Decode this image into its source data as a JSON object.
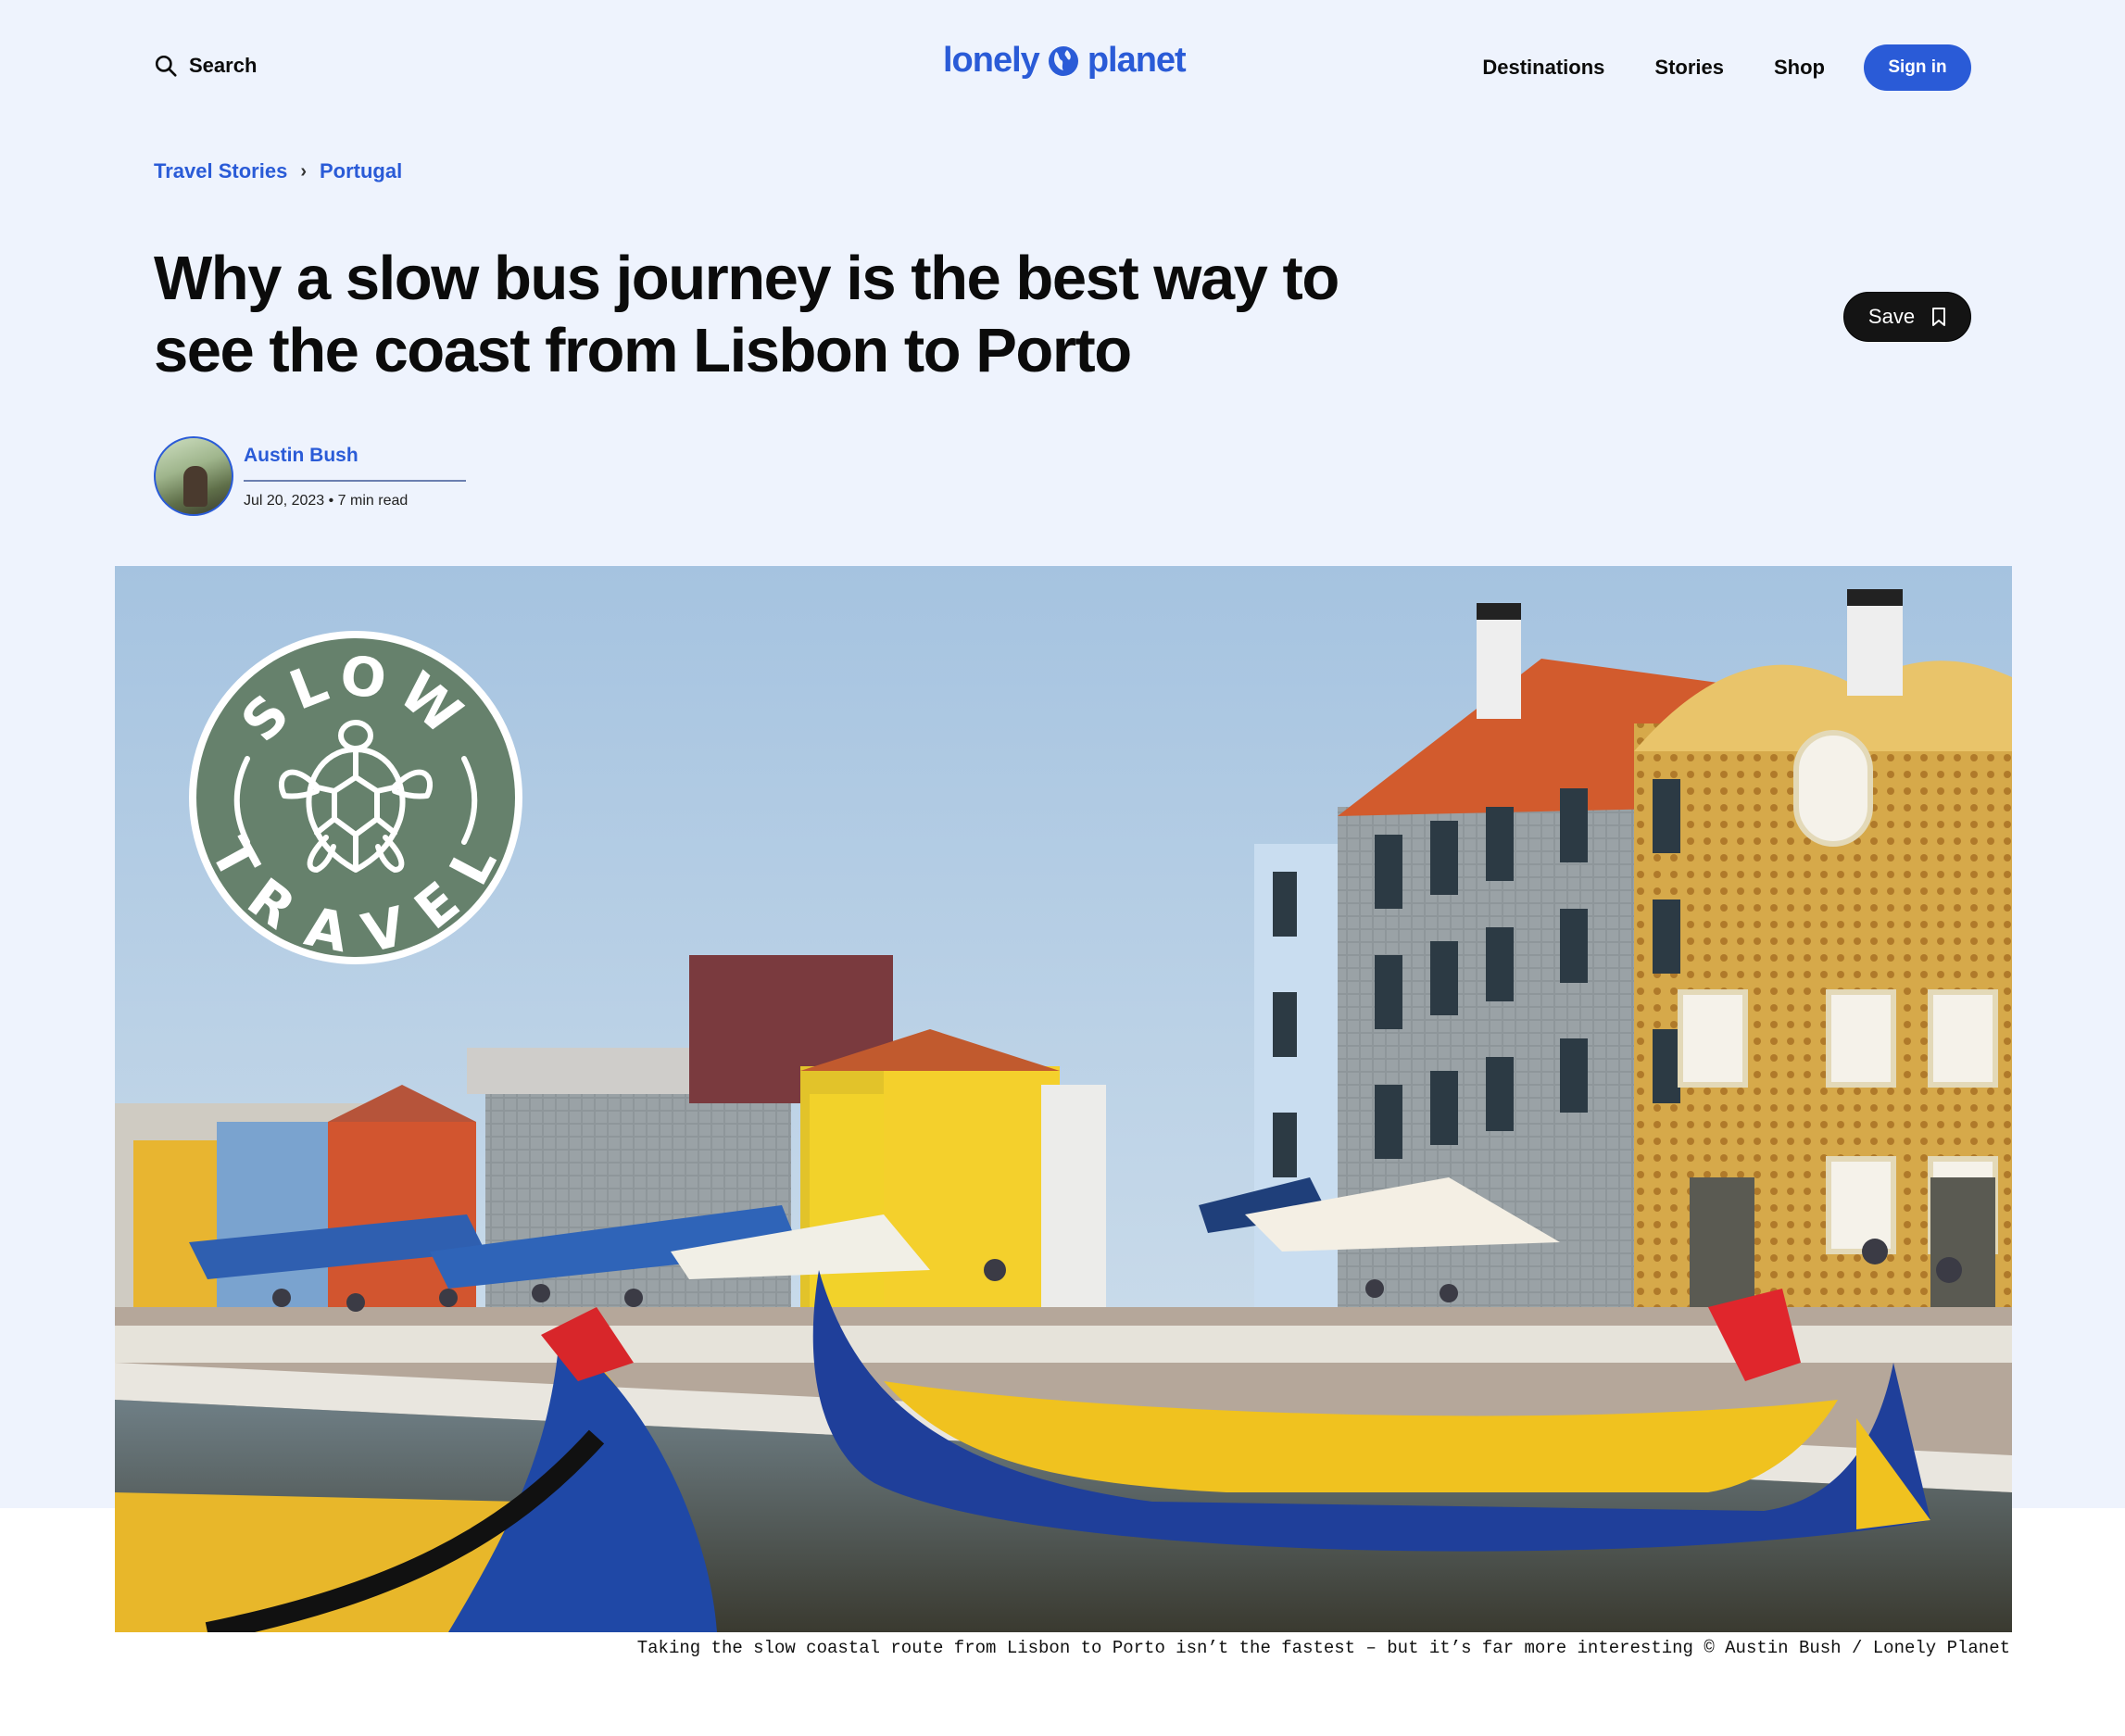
{
  "header": {
    "search_label": "Search",
    "logo_text_left": "lonely",
    "logo_text_right": "planet",
    "nav": [
      "Destinations",
      "Stories",
      "Shop"
    ],
    "signin_label": "Sign in"
  },
  "breadcrumb": [
    "Travel Stories",
    "Portugal"
  ],
  "article": {
    "title": "Why a slow bus journey is the best way to see the coast from Lisbon to Porto",
    "save_label": "Save",
    "author": "Austin Bush",
    "meta": "Jul 20, 2023 • 7 min read"
  },
  "hero": {
    "badge_top": "SLOW",
    "badge_bottom": "TRAVEL",
    "caption": "Taking the slow coastal route from Lisbon to Porto isn’t the fastest – but it’s far more interesting © Austin Bush / Lonely Planet"
  },
  "colors": {
    "brand": "#2a5bd7",
    "page_bg": "#eef3fd",
    "badge_green": "#66816c"
  }
}
